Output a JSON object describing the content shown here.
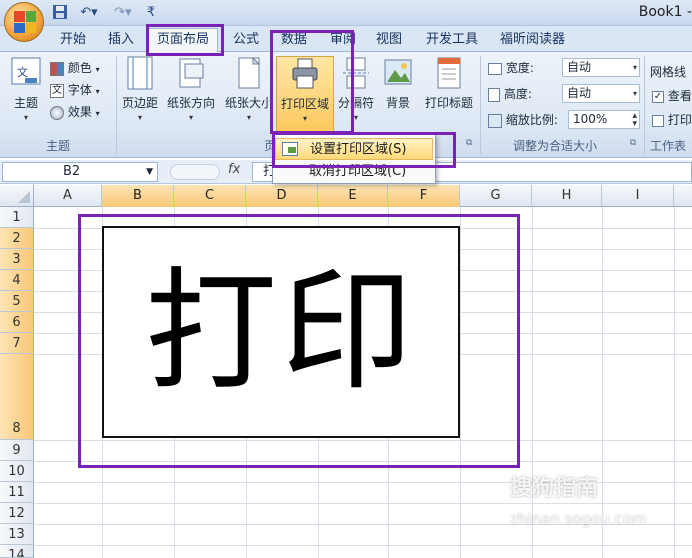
{
  "window": {
    "title": "Book1 -"
  },
  "tabs": [
    {
      "label": "开始"
    },
    {
      "label": "插入"
    },
    {
      "label": "页面布局"
    },
    {
      "label": "公式"
    },
    {
      "label": "数据"
    },
    {
      "label": "审阅"
    },
    {
      "label": "视图"
    },
    {
      "label": "开发工具"
    },
    {
      "label": "福昕阅读器"
    }
  ],
  "ribbon": {
    "theme_group": {
      "label": "主题",
      "theme_btn": "主题",
      "colors": "颜色",
      "fonts": "字体",
      "effects": "效果"
    },
    "page_setup": {
      "label": "页",
      "margins": "页边距",
      "orientation": "纸张方向",
      "size": "纸张大小",
      "print_area": "打印区域",
      "breaks": "分隔符",
      "background": "背景",
      "print_titles": "打印标题"
    },
    "scale_group": {
      "label": "调整为合适大小",
      "width_label": "宽度:",
      "width_value": "自动",
      "height_label": "高度:",
      "height_value": "自动",
      "scale_label": "缩放比例:",
      "scale_value": "100%"
    },
    "sheet_options": {
      "label": "工作表",
      "gridlines": "网格线",
      "view": "查看",
      "print": "打印"
    }
  },
  "print_area_menu": {
    "items": [
      {
        "label": "设置打印区域(S)"
      },
      {
        "label": "取消打印区域(C)"
      }
    ]
  },
  "formula_bar": {
    "name_box": "B2",
    "fx": "fx",
    "content": "打"
  },
  "columns": [
    "A",
    "B",
    "C",
    "D",
    "E",
    "F",
    "G",
    "H",
    "I"
  ],
  "rows": [
    "1",
    "2",
    "3",
    "4",
    "5",
    "6",
    "7",
    "8",
    "9",
    "10",
    "11",
    "12",
    "13",
    "14"
  ],
  "cell_b2": {
    "text": "打印"
  },
  "watermark": {
    "line1": "搜狗指南",
    "line2": "zhinan.sogou.com"
  },
  "colors": {
    "annotation": "#7a22b5",
    "selected_header": "#f8c775"
  }
}
